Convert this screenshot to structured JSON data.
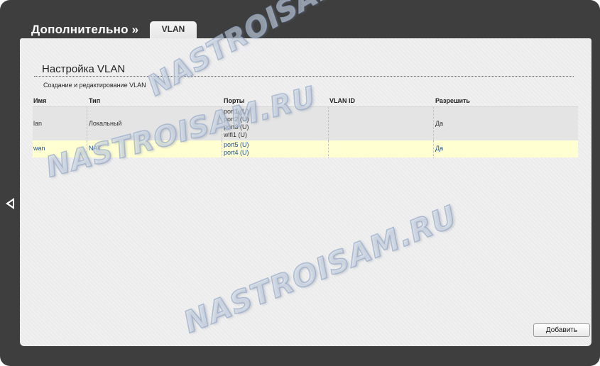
{
  "header": {
    "title": "Дополнительно »",
    "tab_label": "VLAN"
  },
  "section": {
    "title": "Настройка VLAN",
    "subtitle": "Создание и редактирование VLAN"
  },
  "table": {
    "columns": [
      "Имя",
      "Тип",
      "Порты",
      "VLAN ID",
      "Разрешить"
    ],
    "rows": [
      {
        "name": "lan",
        "type": "Локальный",
        "ports": [
          "port1 (U)",
          "port2 (U)",
          "port3 (U)",
          "wifi1 (U)"
        ],
        "vlan_id": "",
        "enabled": "Да"
      },
      {
        "name": "wan",
        "type": "NAT",
        "ports": [
          "port5 (U)",
          "port4 (U)"
        ],
        "vlan_id": "",
        "enabled": "Да"
      }
    ]
  },
  "actions": {
    "add_label": "Добавить"
  },
  "watermark": {
    "text": "NASTROISAM.RU"
  },
  "icons": {
    "nav_back": "chevron-left-icon"
  },
  "colors": {
    "frame": "#3e3e3e",
    "panel": "#ececec",
    "selected_row": "#ffffd2",
    "link": "#1d4f91"
  }
}
